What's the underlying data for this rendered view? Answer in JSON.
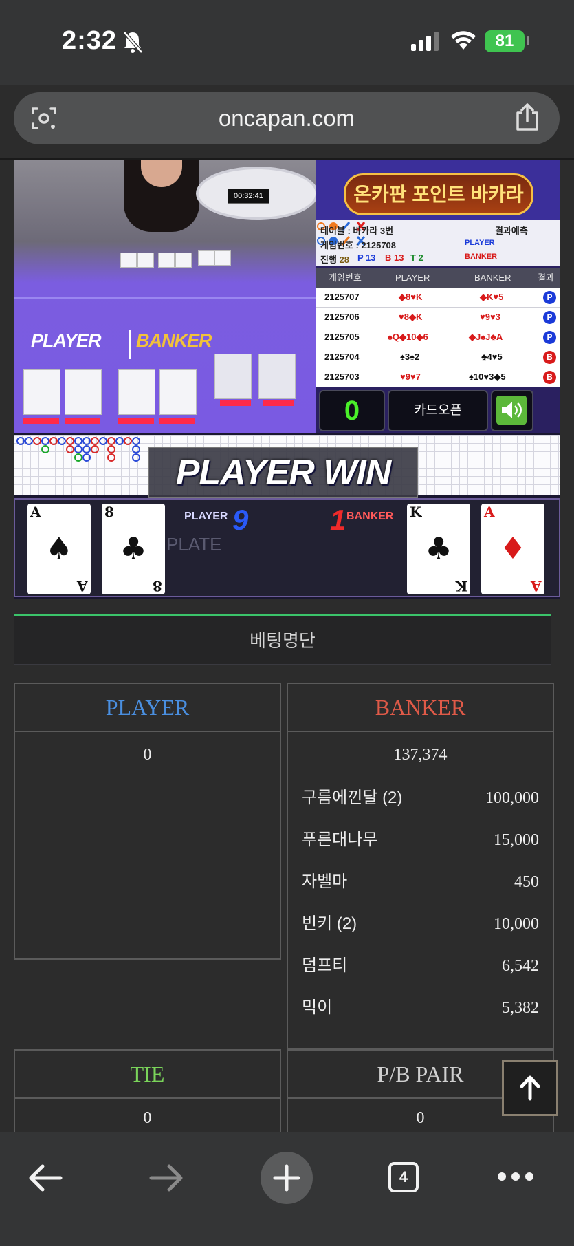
{
  "status": {
    "time": "2:32",
    "battery": "81"
  },
  "browser": {
    "url": "oncapan.com",
    "tab_count": "4"
  },
  "game": {
    "timer": "00:32:41",
    "label_player": "PLAYER",
    "label_banner": "BANKER",
    "banner_title": "온카판 포인트 바카라",
    "info": {
      "table": "테이블 : 바카라 3번",
      "game_no": "게임번호 : 2125708",
      "predict": "결과예측",
      "progress_label": "진행",
      "progress_value": "28",
      "p_count": "P 13",
      "b_count": "B 13",
      "t_count": "T 2",
      "player": "PLAYER",
      "banker": "BANKER"
    },
    "results_headers": [
      "게임번호",
      "PLAYER",
      "BANKER",
      "결과"
    ],
    "results": [
      {
        "no": "2125707",
        "player": "◆8♥K",
        "banker": "◆K♥5",
        "result": "P"
      },
      {
        "no": "2125706",
        "player": "♥8◆K",
        "banker": "♥9♥3",
        "result": "P"
      },
      {
        "no": "2125705",
        "player": "♠Q◆10◆6",
        "banker": "◆J♠J♣A",
        "result": "P"
      },
      {
        "no": "2125704",
        "player": "♠3♠2",
        "banker": "♣4♥5",
        "result": "B"
      },
      {
        "no": "2125703",
        "player": "♥9♥7",
        "banker": "♠10♥3◆5",
        "result": "B"
      }
    ],
    "counter": "0",
    "card_open": "카드오픈",
    "win_text": "PLAYER WIN",
    "player_label": "PLAYER",
    "player_score": "9",
    "banker_label": "BANKER",
    "banker_score": "1",
    "watermark": "PLATE",
    "player_cards": [
      {
        "rank": "A",
        "suit": "♠",
        "color": "#111111"
      },
      {
        "rank": "8",
        "suit": "♣",
        "color": "#111111"
      }
    ],
    "banker_cards": [
      {
        "rank": "K",
        "suit": "♣",
        "color": "#111111"
      },
      {
        "rank": "A",
        "suit": "♦",
        "color": "#d81a1a"
      }
    ]
  },
  "betting": {
    "title": "베팅명단",
    "player": {
      "label": "PLAYER",
      "total": "0",
      "color": "#4a8fe0"
    },
    "banker": {
      "label": "BANKER",
      "total": "137,374",
      "color": "#e05a48",
      "bets": [
        {
          "name": "구름에낀달 (2)",
          "amount": "100,000"
        },
        {
          "name": "푸른대나무",
          "amount": "15,000"
        },
        {
          "name": "자벨마",
          "amount": "450"
        },
        {
          "name": "빈키 (2)",
          "amount": "10,000"
        },
        {
          "name": "덤프티",
          "amount": "6,542"
        },
        {
          "name": "믹이",
          "amount": "5,382"
        }
      ]
    },
    "tie": {
      "label": "TIE",
      "total": "0",
      "color": "#7ad45a"
    },
    "pair": {
      "label": "P/B PAIR",
      "total": "0",
      "color": "#cfcfcf"
    }
  }
}
